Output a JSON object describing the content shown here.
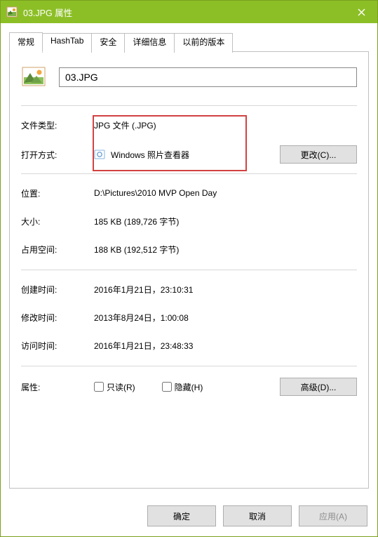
{
  "titlebar": {
    "title": "03.JPG 属性"
  },
  "tabs": {
    "general": "常规",
    "hashtab": "HashTab",
    "security": "安全",
    "details": "详细信息",
    "previous": "以前的版本"
  },
  "header": {
    "filename": "03.JPG"
  },
  "labels": {
    "file_type": "文件类型:",
    "opens_with": "打开方式:",
    "location": "位置:",
    "size": "大小:",
    "size_on_disk": "占用空间:",
    "created": "创建时间:",
    "modified": "修改时间:",
    "accessed": "访问时间:",
    "attributes": "属性:"
  },
  "values": {
    "file_type": "JPG 文件 (.JPG)",
    "opens_with": "Windows 照片查看器",
    "location": "D:\\Pictures\\2010 MVP Open Day",
    "size": "185 KB (189,726 字节)",
    "size_on_disk": "188 KB (192,512 字节)",
    "created": "2016年1月21日，23:10:31",
    "modified": "2013年8月24日，1:00:08",
    "accessed": "2016年1月21日，23:48:33"
  },
  "buttons": {
    "change": "更改(C)...",
    "advanced": "高级(D)...",
    "ok": "确定",
    "cancel": "取消",
    "apply": "应用(A)"
  },
  "checkboxes": {
    "readonly": "只读(R)",
    "hidden": "隐藏(H)"
  }
}
